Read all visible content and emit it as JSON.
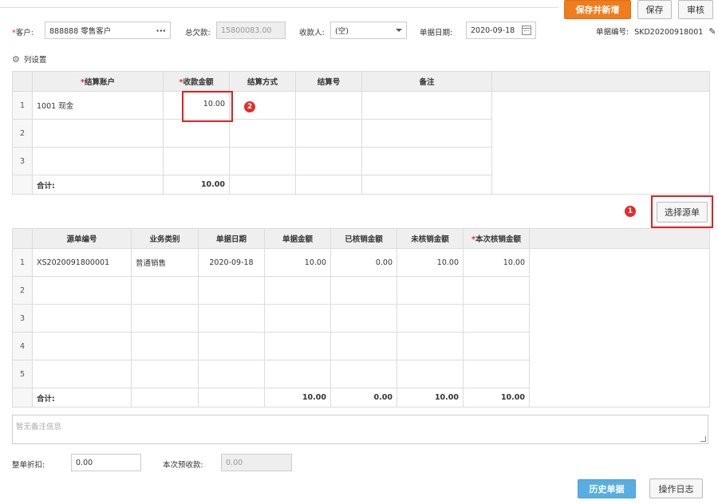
{
  "toolbar": {
    "save_new": "保存并新增",
    "save": "保存",
    "audit": "审核"
  },
  "header": {
    "customer_label": "客户:",
    "customer_value": "888888 零售客户",
    "debt_label": "总欠款:",
    "debt_value": "15800083.00",
    "payee_label": "收款人:",
    "payee_value": "(空)",
    "date_label": "单据日期:",
    "date_value": "2020-09-18",
    "doc_no_label": "单据编号:",
    "doc_no_value": "SKD20200918001"
  },
  "column_settings": "列设置",
  "settlement_table": {
    "headers": [
      "结算账户",
      "收款金额",
      "结算方式",
      "结算号",
      "备注"
    ],
    "rows": [
      {
        "idx": "1",
        "account": "1001 现金",
        "amount": "10.00",
        "method": "",
        "no": "",
        "note": ""
      },
      {
        "idx": "2",
        "account": "",
        "amount": "",
        "method": "",
        "no": "",
        "note": ""
      },
      {
        "idx": "3",
        "account": "",
        "amount": "",
        "method": "",
        "no": "",
        "note": ""
      }
    ],
    "total_label": "合计:",
    "total_amount": "10.00"
  },
  "select_source_button": "选择源单",
  "badges": {
    "one": "1",
    "two": "2"
  },
  "source_table": {
    "headers": [
      "源单编号",
      "业务类别",
      "单据日期",
      "单据金额",
      "已核销金额",
      "未核销金额",
      "本次核销金额"
    ],
    "rows": [
      {
        "idx": "1",
        "no": "XS2020091800001",
        "type": "普通销售",
        "date": "2020-09-18",
        "amount": "10.00",
        "verified": "0.00",
        "unverified": "10.00",
        "current": "10.00"
      },
      {
        "idx": "2",
        "no": "",
        "type": "",
        "date": "",
        "amount": "",
        "verified": "",
        "unverified": "",
        "current": ""
      },
      {
        "idx": "3",
        "no": "",
        "type": "",
        "date": "",
        "amount": "",
        "verified": "",
        "unverified": "",
        "current": ""
      },
      {
        "idx": "4",
        "no": "",
        "type": "",
        "date": "",
        "amount": "",
        "verified": "",
        "unverified": "",
        "current": ""
      },
      {
        "idx": "5",
        "no": "",
        "type": "",
        "date": "",
        "amount": "",
        "verified": "",
        "unverified": "",
        "current": ""
      }
    ],
    "total_label": "合计:",
    "total_amount": "10.00",
    "total_verified": "0.00",
    "total_unverified": "10.00",
    "total_current": "10.00"
  },
  "remark_placeholder": "暂无备注信息",
  "footer": {
    "discount_label": "整单折扣:",
    "discount_value": "0.00",
    "prepay_label": "本次预收款:",
    "prepay_value": "0.00",
    "history_button": "历史单据",
    "log_button": "操作日志"
  },
  "colors": {
    "accent_orange": "#ef7d1f",
    "accent_blue": "#58aee0",
    "highlight_red": "#e02020"
  }
}
